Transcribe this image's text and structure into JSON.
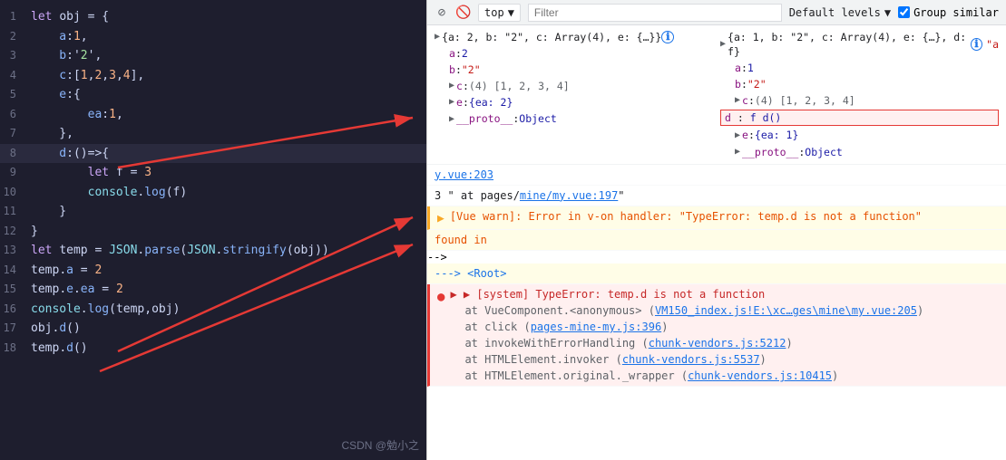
{
  "editor": {
    "lines": [
      {
        "num": 1,
        "tokens": [
          {
            "t": "kw",
            "v": "let "
          },
          {
            "t": "var",
            "v": "obj"
          },
          {
            "t": "punct",
            "v": " = {"
          }
        ]
      },
      {
        "num": 2,
        "tokens": [
          {
            "t": "prop",
            "v": "    a"
          },
          {
            "t": "punct",
            "v": ":"
          },
          {
            "t": "num",
            "v": "1"
          },
          {
            "t": "punct",
            "v": ","
          }
        ]
      },
      {
        "num": 3,
        "tokens": [
          {
            "t": "prop",
            "v": "    b"
          },
          {
            "t": "punct",
            "v": ":'"
          },
          {
            "t": "str",
            "v": "2"
          },
          {
            "t": "punct",
            "v": "',"
          }
        ]
      },
      {
        "num": 4,
        "tokens": [
          {
            "t": "prop",
            "v": "    c"
          },
          {
            "t": "punct",
            "v": ":["
          },
          {
            "t": "num",
            "v": "1"
          },
          {
            "t": "punct",
            "v": ","
          },
          {
            "t": "num",
            "v": "2"
          },
          {
            "t": "punct",
            "v": ","
          },
          {
            "t": "num",
            "v": "3"
          },
          {
            "t": "punct",
            "v": ","
          },
          {
            "t": "num",
            "v": "4"
          },
          {
            "t": "punct",
            "v": "],"
          }
        ]
      },
      {
        "num": 5,
        "tokens": [
          {
            "t": "prop",
            "v": "    e"
          },
          {
            "t": "punct",
            "v": ":{"
          }
        ]
      },
      {
        "num": 6,
        "tokens": [
          {
            "t": "prop",
            "v": "        ea"
          },
          {
            "t": "punct",
            "v": ":"
          },
          {
            "t": "num",
            "v": "1"
          },
          {
            "t": "punct",
            "v": ","
          }
        ]
      },
      {
        "num": 7,
        "tokens": [
          {
            "t": "punct",
            "v": "    },"
          }
        ]
      },
      {
        "num": 8,
        "tokens": [
          {
            "t": "prop",
            "v": "    d"
          },
          {
            "t": "punct",
            "v": ":("
          },
          {
            "t": "punct",
            "v": ")=>"
          },
          {
            "t": "punct",
            "v": "{"
          }
        ],
        "highlight": true
      },
      {
        "num": 9,
        "tokens": [
          {
            "t": "kw",
            "v": "        let "
          },
          {
            "t": "var",
            "v": "f"
          },
          {
            "t": "punct",
            "v": " = "
          },
          {
            "t": "num",
            "v": "3"
          }
        ]
      },
      {
        "num": 10,
        "tokens": [
          {
            "t": "fn",
            "v": "        console"
          },
          {
            "t": "punct",
            "v": "."
          },
          {
            "t": "method",
            "v": "log"
          },
          {
            "t": "punct",
            "v": "("
          },
          {
            "t": "var",
            "v": "f"
          },
          {
            "t": "punct",
            "v": ")"
          }
        ]
      },
      {
        "num": 11,
        "tokens": [
          {
            "t": "punct",
            "v": "    }"
          }
        ]
      },
      {
        "num": 12,
        "tokens": [
          {
            "t": "punct",
            "v": "}"
          }
        ]
      },
      {
        "num": 13,
        "tokens": [
          {
            "t": "kw",
            "v": "let "
          },
          {
            "t": "var",
            "v": "temp"
          },
          {
            "t": "punct",
            "v": " = "
          },
          {
            "t": "fn",
            "v": "JSON"
          },
          {
            "t": "punct",
            "v": "."
          },
          {
            "t": "method",
            "v": "parse"
          },
          {
            "t": "punct",
            "v": "("
          },
          {
            "t": "fn",
            "v": "JSON"
          },
          {
            "t": "punct",
            "v": "."
          },
          {
            "t": "method",
            "v": "stringify"
          },
          {
            "t": "punct",
            "v": "("
          },
          {
            "t": "var",
            "v": "obj"
          },
          {
            "t": "punct",
            "v": "))"
          }
        ]
      },
      {
        "num": 14,
        "tokens": [
          {
            "t": "var",
            "v": "temp"
          },
          {
            "t": "punct",
            "v": "."
          },
          {
            "t": "prop",
            "v": "a"
          },
          {
            "t": "punct",
            "v": " = "
          },
          {
            "t": "num",
            "v": "2"
          }
        ]
      },
      {
        "num": 15,
        "tokens": [
          {
            "t": "var",
            "v": "temp"
          },
          {
            "t": "punct",
            "v": "."
          },
          {
            "t": "prop",
            "v": "e"
          },
          {
            "t": "punct",
            "v": "."
          },
          {
            "t": "prop",
            "v": "ea"
          },
          {
            "t": "punct",
            "v": " = "
          },
          {
            "t": "num",
            "v": "2"
          }
        ]
      },
      {
        "num": 16,
        "tokens": [
          {
            "t": "fn",
            "v": "console"
          },
          {
            "t": "punct",
            "v": "."
          },
          {
            "t": "method",
            "v": "log"
          },
          {
            "t": "punct",
            "v": "("
          },
          {
            "t": "var",
            "v": "temp"
          },
          {
            "t": "punct",
            "v": ","
          },
          {
            "t": "var",
            "v": "obj"
          },
          {
            "t": "punct",
            "v": ")"
          }
        ]
      },
      {
        "num": 17,
        "tokens": [
          {
            "t": "var",
            "v": "obj"
          },
          {
            "t": "punct",
            "v": "."
          },
          {
            "t": "method",
            "v": "d"
          },
          {
            "t": "punct",
            "v": "()"
          }
        ],
        "arrow": true
      },
      {
        "num": 18,
        "tokens": [
          {
            "t": "var",
            "v": "temp"
          },
          {
            "t": "punct",
            "v": "."
          },
          {
            "t": "method",
            "v": "d"
          },
          {
            "t": "punct",
            "v": "()"
          }
        ],
        "arrow": true
      }
    ]
  },
  "devtools": {
    "toolbar": {
      "stop_icon": "⊘",
      "clear_icon": "🚫",
      "context_label": "top",
      "filter_placeholder": "Filter",
      "levels_label": "Default levels",
      "group_similar_label": "Group similar"
    },
    "console_output": {
      "obj1_header": "▶ {a: 2, b: \"2\", c: Array(4), e: {…}}",
      "obj1_info": "ℹ",
      "obj2_header": "▶ {a: 1, b: \"2\", c: Array(4), e: {…}, d: f}",
      "obj2_info": "ℹ",
      "obj1_expanded": {
        "a": "2",
        "b": "\"2\"",
        "c": "(4) [1, 2, 3, 4]",
        "e": "{ea: 2}",
        "proto": "Object"
      },
      "obj2_expanded": {
        "a": "1",
        "b": "\"2\"",
        "c": "(4) [1, 2, 3, 4]",
        "d": "f d()",
        "e": "{ea: 1}",
        "proto": "Object"
      },
      "source_loc1": "y.vue:203",
      "vue_warn": "3 \" at pages/mine/my.vue:197\"",
      "vue_warn2": "[Vue warn]: Error in v-on handler: \"TypeError: temp.d is not a function\"",
      "vue_found": "found in",
      "vue_root": "---> <Root>",
      "error_msg": "▶ [system] TypeError: temp.d is not a function",
      "stack1": "at VueComponent.<anonymous> (VM150_index.js!E:\\xc…ges\\mine\\my.vue:205)",
      "stack2": "at click (pages-mine-my.js:396)",
      "stack3": "at invokeWithErrorHandling (chunk-vendors.js:5212)",
      "stack4": "at HTMLElement.invoker (chunk-vendors.js:5537)",
      "stack5": "at HTMLElement.original._wrapper (chunk-vendors.js:10415)"
    }
  },
  "watermark": "CSDN @勉小之"
}
